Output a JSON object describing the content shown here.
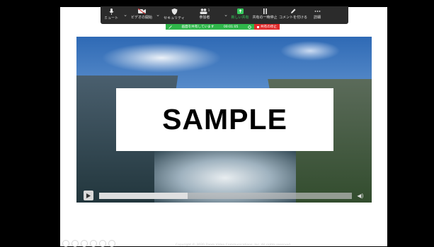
{
  "toolbar": {
    "mute_label": "ミュート",
    "video_label": "ビデオの開始",
    "security_label": "セキュリティ",
    "participants_label": "参加者",
    "participants_count": "1",
    "new_share_label": "新しい共有",
    "pause_share_label": "共有の一時停止",
    "annotate_label": "コメントを付ける",
    "more_label": "詳細"
  },
  "share_bar": {
    "status_text": "画面を共有しています",
    "timer": "00:01:05",
    "stop_label": "共有の停止"
  },
  "video": {
    "overlay_text": "SAMPLE",
    "progress": 0.35
  },
  "footer": {
    "copyright": "Copyright © 2020 Zoom Video Communications, Inc. All rights reserved."
  },
  "colors": {
    "toolbar_bg": "#2b2b2b",
    "share_green": "#2fb64a",
    "stop_red": "#e02b2b",
    "new_share_green": "#35c95b"
  }
}
